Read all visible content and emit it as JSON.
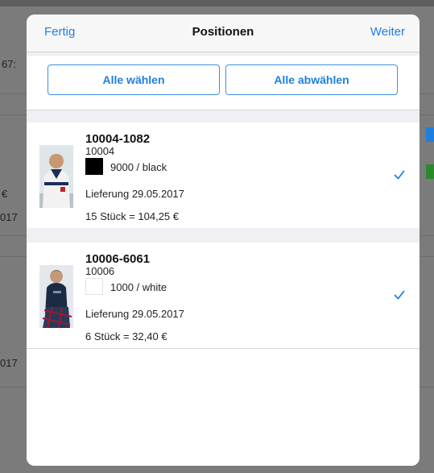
{
  "background": {
    "snippets": [
      "67:",
      "€",
      "017",
      "017"
    ],
    "badge_colors": [
      "#1f7fe0",
      "#2c8a2c"
    ]
  },
  "nav": {
    "left": "Fertig",
    "title": "Positionen",
    "right": "Weiter"
  },
  "buttons": {
    "select_all": "Alle wählen",
    "deselect_all": "Alle abwählen"
  },
  "items": [
    {
      "article": "10004-1082",
      "model": "10004",
      "color_label": "9000 / black",
      "swatch_color": "#000000",
      "delivery": "Lieferung 29.05.2017",
      "quantity": "15 Stück = 104,25 €",
      "checked": true
    },
    {
      "article": "10006-6061",
      "model": "10006",
      "color_label": "1000 / white",
      "swatch_color": "#ffffff",
      "delivery": "Lieferung 29.05.2017",
      "quantity": "6 Stück = 32,40 €",
      "checked": true
    }
  ],
  "colors": {
    "accent": "#1f7fe0"
  }
}
